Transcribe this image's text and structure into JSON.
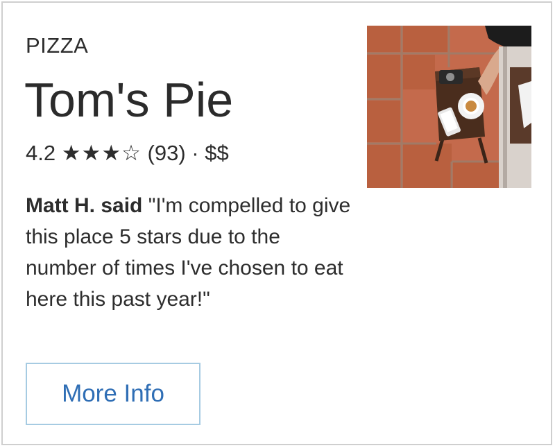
{
  "card": {
    "category": "PIZZA",
    "name": "Tom's Pie",
    "rating": "4.2",
    "stars": "★★★☆",
    "review_count": "(93)",
    "separator": "·",
    "price": "$$",
    "review_author": "Matt H. said",
    "review_text": "\"I'm compelled to give this place 5 stars due to the number of times I've chosen to eat here this past year!\"",
    "button_label": "More Info",
    "image": "restaurant-photo-table-coffee-cup"
  },
  "colors": {
    "accent": "#2f6eb5",
    "button_border": "#a6cbe2",
    "text": "#2b2b2b",
    "card_border": "#cfcfcf"
  }
}
